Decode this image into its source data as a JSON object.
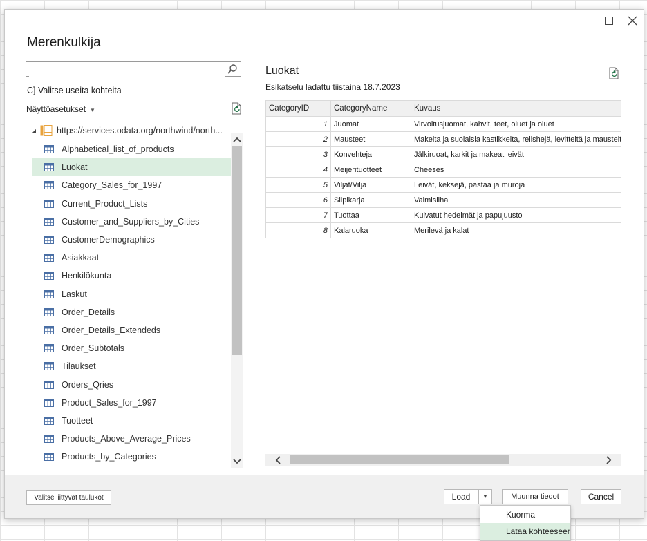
{
  "dialog": {
    "title": "Merenkulkija",
    "maximize_icon": "maximize-icon",
    "close_icon": "close-icon"
  },
  "left_panel": {
    "search": {
      "value": "",
      "placeholder": ""
    },
    "multi_select_label": "C] Valitse useita kohteita",
    "display_options_label": "Näyttöasetukset",
    "tree_root_label": "https://services.odata.org/northwind/north...",
    "items": [
      "Alphabetical_list_of_products",
      "Luokat",
      "Category_Sales_for_1997",
      "Current_Product_Lists",
      "Customer_and_Suppliers_by_Cities",
      "CustomerDemographics",
      "Asiakkaat",
      "Henkilökunta",
      "Laskut",
      "Order_Details",
      "Order_Details_Extendeds",
      "Order_Subtotals",
      "Tilaukset",
      "Orders_Qries",
      "Product_Sales_for_1997",
      "Tuotteet",
      "Products_Above_Average_Prices",
      "Products_by_Categories"
    ],
    "selected_item": "Luokat"
  },
  "preview": {
    "title": "Luokat",
    "subtitle": "Esikatselu ladattu tiistaina 18.7.2023",
    "columns": [
      "CategoryID",
      "CategoryName",
      "Kuvaus"
    ],
    "rows": [
      [
        "1",
        "Juomat",
        "Virvoitusjuomat, kahvit, teet, oluet ja oluet"
      ],
      [
        "2",
        "Mausteet",
        "Makeita ja suolaisia kastikkeita, relishejä, levitteitä ja mausteita"
      ],
      [
        "3",
        "Konvehteja",
        "Jälkiruoat, karkit ja makeat leivät"
      ],
      [
        "4",
        "Meijerituotteet",
        "Cheeses"
      ],
      [
        "5",
        "Viljat/Vilja",
        "Leivät, keksejä, pastaa ja muroja"
      ],
      [
        "6",
        "Siipikarja",
        "Valmisliha"
      ],
      [
        "7",
        "Tuottaa",
        "Kuivatut hedelmät ja papujuusto"
      ],
      [
        "8",
        "Kalaruoka",
        "Merilevä ja kalat"
      ]
    ]
  },
  "footer": {
    "related_tables_label": "Valitse liittyvät taulukot",
    "load_label": "Load",
    "transform_label": "Muunna tiedot",
    "cancel_label": "Cancel"
  },
  "load_menu": {
    "items": [
      "Kuorma",
      "Lataa kohteeseen..."
    ]
  },
  "colors": {
    "selection": "#dbeee0",
    "excel_green": "#1e7145",
    "table_icon_blue": "#4a6fa5",
    "db_icon_orange": "#e8a33d"
  }
}
